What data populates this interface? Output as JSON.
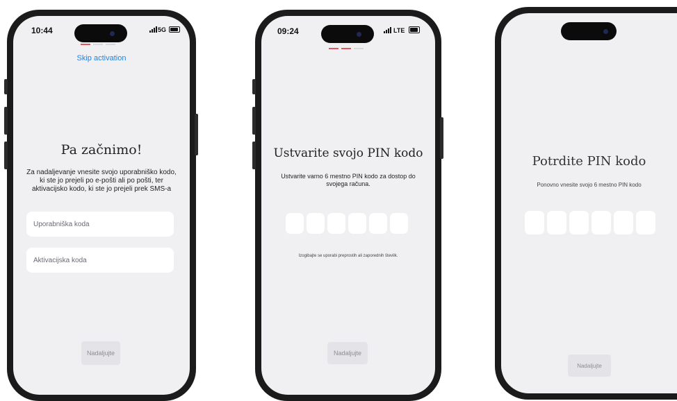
{
  "screens": [
    {
      "status_time": "10:44",
      "status_right": "5G",
      "skip_label": "Skip activation",
      "title": "Pa začnimo!",
      "description": "Za nadaljevanje vnesite svojo uporabniško kodo, ki ste jo prejeli po e-pošti ali po pošti, ter aktivacijsko kodo, ki ste jo prejeli prek SMS-a",
      "user_code_placeholder": "Uporabniška koda",
      "activation_code_placeholder": "Aktivacijska koda",
      "continue_label": "Nadaljujte",
      "progress_active_steps": 1
    },
    {
      "status_time": "09:24",
      "status_right": "LTE",
      "title": "Ustvarite svojo PIN kodo",
      "description": "Ustvarite varno 6 mestno PIN kodo za dostop do svojega računa.",
      "pin_length": 6,
      "hint": "Izogibajte se uporabi preprostih ali zaporednih številk.",
      "continue_label": "Nadaljujte",
      "progress_active_steps": 2
    },
    {
      "title": "Potrdite PIN kodo",
      "description": "Ponovno vnesite svojo 6 mestno PIN kodo",
      "pin_length": 6,
      "continue_label": "Nadaljujte"
    }
  ],
  "colors": {
    "accent_progress": "#e0565b",
    "link": "#2a7fd4",
    "screen_bg": "#f0f0f3",
    "disabled_button": "#e4e4e8"
  }
}
